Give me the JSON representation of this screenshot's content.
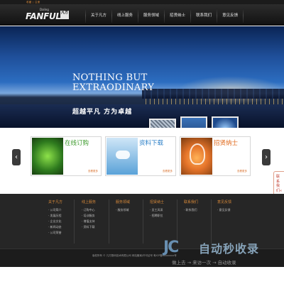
{
  "util_bar": {
    "links": "收藏 | 注册"
  },
  "header": {
    "logo_main": "FANFULL",
    "logo_sub": "Daling",
    "logo_badge": "凡方",
    "nav": [
      "关于凡方",
      "线上服务",
      "服务领域",
      "招贤纳士",
      "联系我们",
      "意见反馈"
    ]
  },
  "banner": {
    "headline_line1": "NOTHING BUT",
    "headline_line2": "EXTRAODINARY",
    "slogan": "超越平凡  方为卓越"
  },
  "products": {
    "arrow_left": "‹",
    "arrow_right": "›",
    "cards": [
      {
        "title": "在线订购",
        "more": "查看更多"
      },
      {
        "title": "资料下载",
        "more": "查看更多"
      },
      {
        "title": "招贤纳士",
        "more": "查看更多"
      }
    ]
  },
  "side_tab": {
    "label": "联系我们«"
  },
  "footer": {
    "columns": [
      {
        "heading": "关于凡方",
        "links": [
          "· 公司简介",
          "· 发展历程",
          "· 企业文化",
          "· 新闻动态",
          "· 公司荣誉"
        ]
      },
      {
        "heading": "线上服务",
        "links": [
          "· 订购中心",
          "· 培训服务",
          "· 增值支持",
          "· 资料下载"
        ]
      },
      {
        "heading": "服务领域",
        "links": [
          "· 服务领域"
        ]
      },
      {
        "heading": "招贤纳士",
        "links": [
          "· 员工风采",
          "· 招聘职位"
        ]
      },
      {
        "heading": "联系我们",
        "links": [
          "· 联系我们"
        ]
      },
      {
        "heading": "意见反馈",
        "links": [
          "· 意见反馈"
        ]
      }
    ],
    "copyright": "版权所有 © 凡方数码技术有限公司 网站备案/许可证号 粤ICP备xxxxxxxx号"
  },
  "watermark": {
    "logo": "JC",
    "title": "自动秒收录",
    "subtitle": "做上去 → 来访一次 → 自动收录"
  }
}
